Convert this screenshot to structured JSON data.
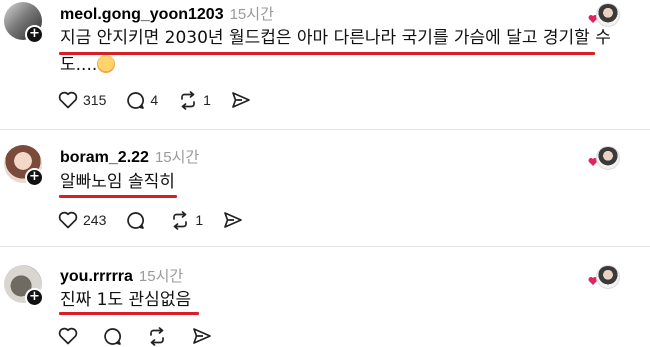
{
  "comments": [
    {
      "username": "meol.gong_yoon1203",
      "time": "15시간",
      "text_line1": "지금 안지키면 2030년 월드컵은 아마 다른나라 국기를 가슴에 달고 경기할 수",
      "text_line2": "도....",
      "emoji": "flushed-face-emoji",
      "likes": "315",
      "replies": "4",
      "reposts": "1"
    },
    {
      "username": "boram_2.22",
      "time": "15시간",
      "text_line1": "알빠노임 솔직히",
      "likes": "243",
      "replies": "",
      "reposts": "1"
    },
    {
      "username": "you.rrrrra",
      "time": "15시간",
      "text_line1": "진짜 1도 관심없음"
    }
  ],
  "colors": {
    "underline": "#d61f26",
    "muted": "#9a9a9a",
    "text": "#111111"
  }
}
